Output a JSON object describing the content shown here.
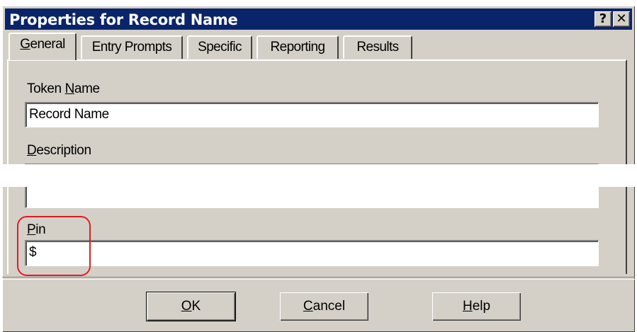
{
  "dialog": {
    "title": "Properties for Record Name",
    "help_button": "?",
    "close_button": "✕"
  },
  "tabs": [
    {
      "mnemonic": "G",
      "rest": "eneral",
      "active": true
    },
    {
      "label": "Entry Prompts"
    },
    {
      "label": "Specific"
    },
    {
      "label": "Reporting"
    },
    {
      "label": "Results"
    }
  ],
  "fields": {
    "token_name": {
      "label_pre": "Token ",
      "mnemonic": "N",
      "label_post": "ame",
      "value": "Record Name"
    },
    "description": {
      "mnemonic": "D",
      "label_post": "escription",
      "value": ""
    },
    "pin": {
      "mnemonic": "P",
      "label_post": "in",
      "value": "$"
    }
  },
  "buttons": {
    "ok": {
      "mnemonic": "O",
      "rest": "K"
    },
    "cancel": {
      "mnemonic": "C",
      "rest": "ancel"
    },
    "help": {
      "mnemonic": "H",
      "rest": "elp"
    }
  },
  "colors": {
    "title_bar": "#0a246a",
    "face": "#d4d0c8",
    "annotation": "#e8191e"
  }
}
